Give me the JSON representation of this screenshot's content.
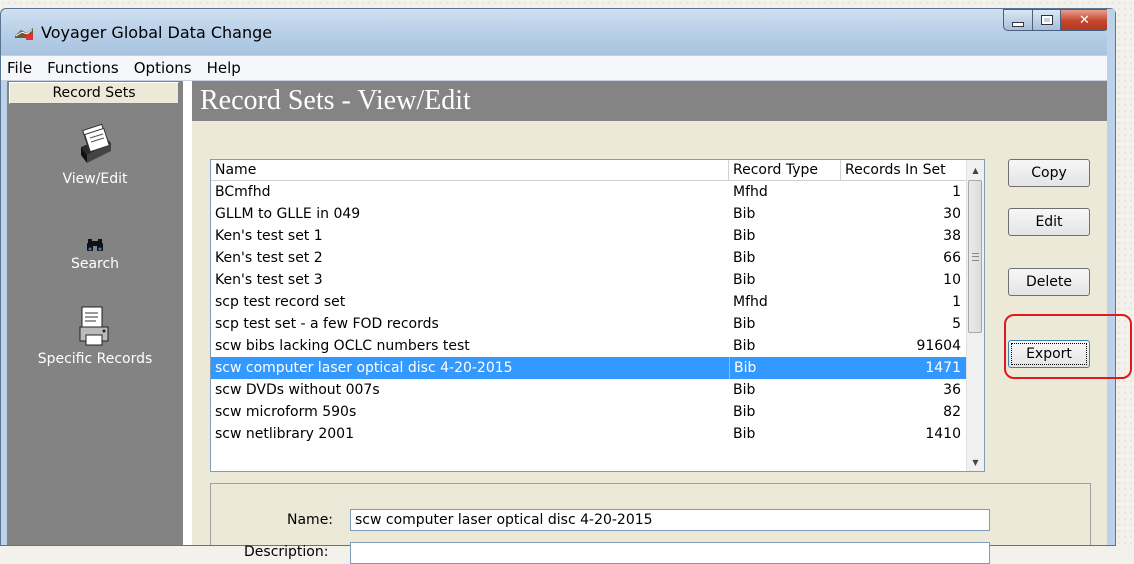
{
  "window": {
    "title": "Voyager Global Data Change"
  },
  "menu": [
    "File",
    "Functions",
    "Options",
    "Help"
  ],
  "sidebar": {
    "header": "Record Sets",
    "items": [
      {
        "label": "View/Edit",
        "icon": "card-file-icon"
      },
      {
        "label": "Search",
        "icon": "binoculars-icon"
      },
      {
        "label": "Specific Records",
        "icon": "document-printer-icon"
      }
    ]
  },
  "main": {
    "title": "Record Sets - View/Edit",
    "columns": [
      "Name",
      "Record Type",
      "Records In Set"
    ],
    "rows": [
      {
        "name": "BCmfhd",
        "type": "Mfhd",
        "count": "1"
      },
      {
        "name": "GLLM to GLLE in 049",
        "type": "Bib",
        "count": "30"
      },
      {
        "name": "Ken's test set 1",
        "type": "Bib",
        "count": "38"
      },
      {
        "name": "Ken's test set 2",
        "type": "Bib",
        "count": "66"
      },
      {
        "name": "Ken's test set 3",
        "type": "Bib",
        "count": "10"
      },
      {
        "name": "scp test record set",
        "type": "Mfhd",
        "count": "1"
      },
      {
        "name": "scp test set - a few FOD records",
        "type": "Bib",
        "count": "5"
      },
      {
        "name": "scw bibs lacking OCLC numbers test",
        "type": "Bib",
        "count": "91604"
      },
      {
        "name": "scw computer laser optical disc 4-20-2015",
        "type": "Bib",
        "count": "1471",
        "selected": true
      },
      {
        "name": "scw DVDs without 007s",
        "type": "Bib",
        "count": "36"
      },
      {
        "name": "scw microform 590s",
        "type": "Bib",
        "count": "82"
      },
      {
        "name": "scw netlibrary 2001",
        "type": "Bib",
        "count": "1410"
      }
    ],
    "buttons": {
      "copy": "Copy",
      "edit": "Edit",
      "delete": "Delete",
      "export": "Export"
    },
    "detail": {
      "name_label": "Name:",
      "name_value": "scw computer laser optical disc 4-20-2015",
      "description_label": "Description:"
    }
  },
  "colors": {
    "selection": "#3399ff",
    "sidebar": "#838383",
    "highlight": "#e0191b"
  }
}
